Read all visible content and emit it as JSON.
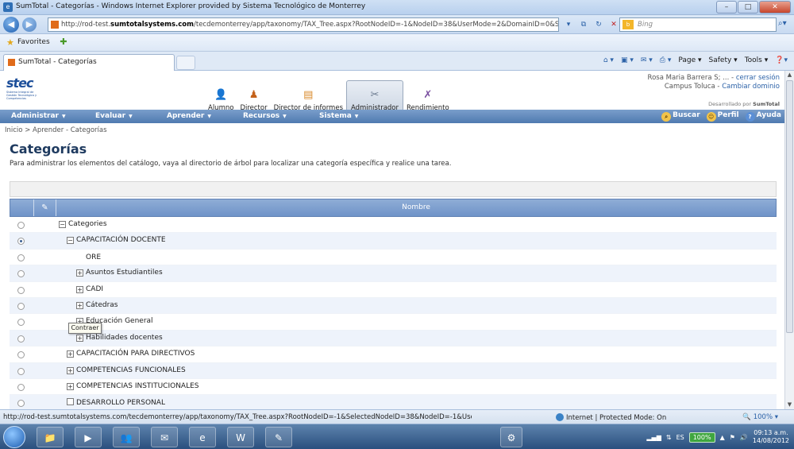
{
  "window": {
    "title": "SumTotal - Categorías - Windows Internet Explorer provided by Sistema Tecnológico de Monterrey"
  },
  "browser": {
    "url_prefix": "http://rod-test.",
    "url_domain": "sumtotalsystems.com",
    "url_rest": "/tecdemonterrey/app/taxonomy/TAX_Tree.aspx?RootNodeID=-1&NodeID=38&UserMode=2&DomainID=0&SecNodeID=0",
    "search_placeholder": "Bing",
    "favorites_label": "Favorites",
    "tab_title": "SumTotal - Categorías",
    "commands": [
      "Page ▾",
      "Safety ▾",
      "Tools ▾"
    ]
  },
  "header": {
    "logo_text": "stec",
    "logo_sub": "Sistema Integral de Gestión Tecnológica y Competencias",
    "user_name": "Rosa Maria Barrera S; ...",
    "logout_label": "cerrar sesión",
    "campus": "Campus Toluca",
    "change_domain_label": "Cambiar dominio",
    "powered_prefix": "Desarrollado por",
    "powered_brand": "SumTotal",
    "roles": [
      {
        "label": "Alumno",
        "icon": "student-icon"
      },
      {
        "label": "Director",
        "icon": "director-icon"
      },
      {
        "label": "Director de informes",
        "icon": "reports-icon"
      },
      {
        "label": "Administrador",
        "icon": "admin-icon"
      },
      {
        "label": "Rendimiento",
        "icon": "performance-icon"
      }
    ]
  },
  "menu": {
    "items": [
      "Administrar",
      "Evaluar",
      "Aprender",
      "Recursos",
      "Sistema"
    ],
    "search_label": "Buscar",
    "profile_label": "Perfil",
    "help_label": "Ayuda"
  },
  "breadcrumb": "Inicio > Aprender - Categorías",
  "page": {
    "title": "Categorías",
    "description": "Para administrar los elementos del catálogo, vaya al directorio de árbol para localizar una categoría específica y realice una tarea."
  },
  "grid": {
    "column_name": "Nombre",
    "tooltip": "Contraer",
    "rows": [
      {
        "label": "Categories",
        "toggle": "−",
        "level": 0,
        "selected": false
      },
      {
        "label": "CAPACITACIÓN DOCENTE",
        "toggle": "−",
        "level": 1,
        "selected": true
      },
      {
        "label": "ORE",
        "toggle": "",
        "level": 2,
        "selected": false
      },
      {
        "label": "Asuntos Estudiantiles",
        "toggle": "+",
        "level": 2,
        "selected": false
      },
      {
        "label": "CADI",
        "toggle": "+",
        "level": 2,
        "selected": false
      },
      {
        "label": "Cátedras",
        "toggle": "+",
        "level": 2,
        "selected": false
      },
      {
        "label": "Educación General",
        "toggle": "+",
        "level": 2,
        "selected": false
      },
      {
        "label": "Habilidades docentes",
        "toggle": "+",
        "level": 2,
        "selected": false
      },
      {
        "label": "CAPACITACIÓN PARA DIRECTIVOS",
        "toggle": "+",
        "level": 1,
        "selected": false
      },
      {
        "label": "COMPETENCIAS FUNCIONALES",
        "toggle": "+",
        "level": 1,
        "selected": false
      },
      {
        "label": "COMPETENCIAS INSTITUCIONALES",
        "toggle": "+",
        "level": 1,
        "selected": false
      },
      {
        "label": "DESARROLLO PERSONAL",
        "toggle": "",
        "level": 1,
        "selected": false
      }
    ]
  },
  "status": {
    "url": "http://rod-test.sumtotalsystems.com/tecdemonterrey/app/taxonomy/TAX_Tree.aspx?RootNodeID=-1&SelectedNodeID=38&NodeID=-1&UserMode=2&",
    "zone": "Internet | Protected Mode: On",
    "zoom": "100%"
  },
  "taskbar": {
    "lang": "ES",
    "battery": "100%",
    "time": "09:13 a.m.",
    "date": "14/08/2012"
  }
}
